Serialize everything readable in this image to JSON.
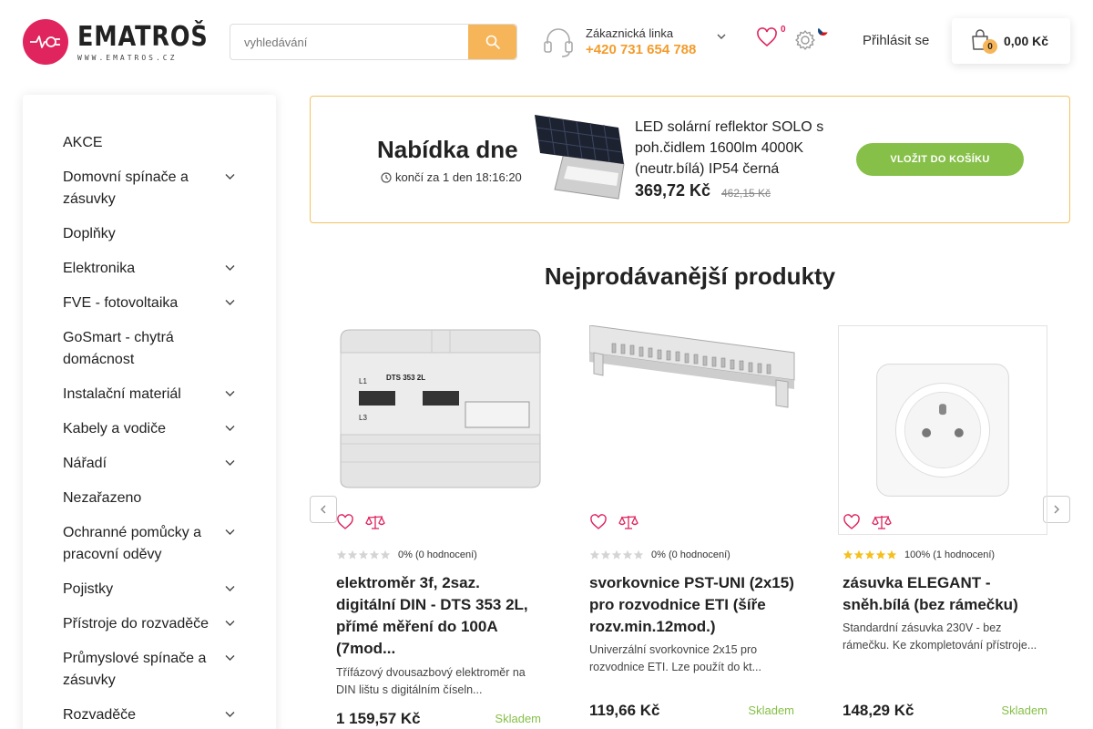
{
  "header": {
    "logo_text": "EMATROŠ",
    "logo_sub": "WWW.EMATROS.CZ",
    "search_placeholder": "vyhledávání",
    "support_label": "Zákaznická linka",
    "support_phone": "+420 731 654 788",
    "wishlist_count": "0",
    "login_label": "Přihlásit se",
    "cart_count": "0",
    "cart_total": "0,00 Kč",
    "accent_color": "#f7b559",
    "brand_color": "#e0245e"
  },
  "sidebar": {
    "items": [
      {
        "label": "AKCE",
        "has_children": false
      },
      {
        "label": "Domovní spínače a zásuvky",
        "has_children": true
      },
      {
        "label": "Doplňky",
        "has_children": false
      },
      {
        "label": "Elektronika",
        "has_children": true
      },
      {
        "label": "FVE - fotovoltaika",
        "has_children": true
      },
      {
        "label": "GoSmart - chytrá domácnost",
        "has_children": false
      },
      {
        "label": "Instalační materiál",
        "has_children": true
      },
      {
        "label": "Kabely a vodiče",
        "has_children": true
      },
      {
        "label": "Nářadí",
        "has_children": true
      },
      {
        "label": "Nezařazeno",
        "has_children": false
      },
      {
        "label": "Ochranné pomůcky a pracovní oděvy",
        "has_children": true
      },
      {
        "label": "Pojistky",
        "has_children": true
      },
      {
        "label": "Přístroje do rozvaděče",
        "has_children": true
      },
      {
        "label": "Průmyslové spínače a zásuvky",
        "has_children": true
      },
      {
        "label": "Rozvaděče",
        "has_children": true
      }
    ]
  },
  "deal": {
    "title": "Nabídka dne",
    "timer": "končí za 1 den 18:16:20",
    "product_name": "LED solární reflektor SOLO s poh.čidlem 1600lm 4000K (neutr.bílá) IP54 černá",
    "price": "369,72 Kč",
    "old_price": "462,15 Kč",
    "button_label": "VLOŽIT DO KOŠÍKU"
  },
  "bestsellers": {
    "title": "Nejprodávanější produkty",
    "products": [
      {
        "name": "elektroměr 3f, 2saz. digitální DIN - DTS 353 2L, přímé měření do 100A (7mod...",
        "desc": "Třífázový dvousazbový elektroměr na DIN lištu s digitálním číseln...",
        "rating_text": "0% (0 hodnocení)",
        "stars": 0,
        "price": "1 159,57 Kč",
        "stock": "Skladem",
        "img_label": "DTS 353 2L"
      },
      {
        "name": "svorkovnice PST-UNI (2x15) pro rozvodnice ETI (šíře rozv.min.12mod.)",
        "desc": "Univerzální svorkovnice 2x15 pro rozvodnice ETI. Lze použít do kt...",
        "rating_text": "0% (0 hodnocení)",
        "stars": 0,
        "price": "119,66 Kč",
        "stock": "Skladem"
      },
      {
        "name": "zásuvka ELEGANT - sněh.bílá (bez rámečku)",
        "desc": "Standardní zásuvka 230V - bez rámečku. Ke zkompletování přístroje...",
        "rating_text": "100% (1 hodnocení)",
        "stars": 5,
        "price": "148,29 Kč",
        "stock": "Skladem"
      }
    ]
  }
}
